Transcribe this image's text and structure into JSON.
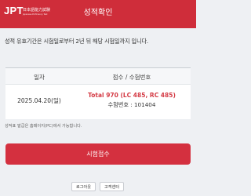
{
  "header": {
    "logo_text": "JPT",
    "logo_sub": "日本語能力試験",
    "logo_tagline": "Japanese Proficiency Test",
    "title": "성적확인"
  },
  "notice": "성적 유효기간은 시험일로부터 2년 뒤 해당 시험일까지 입니다.",
  "table": {
    "headers": {
      "date": "일자",
      "score": "점수 / 수험번호"
    },
    "rows": [
      {
        "date": "2025.04.20(일)",
        "total": "Total 970 (LC 485, RC 485)",
        "exam_number": "수험번호 : 101404"
      }
    ]
  },
  "footnote": "성적표 발급은 홈페이지(PC)에서 가능합니다.",
  "buttons": {
    "apply": "시험접수",
    "logout": "로그아웃",
    "support": "고객센터"
  },
  "colors": {
    "brand": "#cf2d3a",
    "score_text": "#d43b45",
    "background": "#eef0f3"
  }
}
